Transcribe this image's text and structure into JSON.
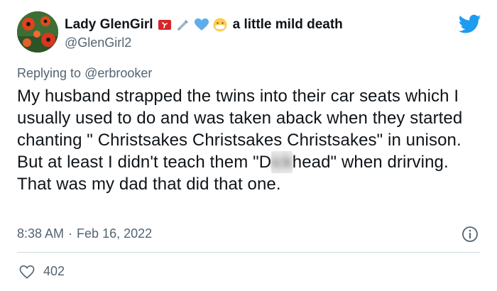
{
  "author": {
    "display_name": "Lady GlenGirl",
    "handle": "@GlenGirl2",
    "status_text": "a little mild death"
  },
  "status_emojis": [
    "isle-of-man-flag-icon",
    "syringe-icon",
    "blue-heart-icon",
    "medical-mask-face-icon"
  ],
  "reply": {
    "prefix": "Replying to",
    "mention": "@erbrooker"
  },
  "body": {
    "before_blur": "My husband strapped the twins into their car seats which I usually used to do and was taken aback when they started chanting \" Christsakes Christsakes Christsakes\" in unison. But at least I didn't teach them \"D",
    "blurred": "ick",
    "after_blur": "head\" when drirving. That was my dad that did that one."
  },
  "meta": {
    "time": "8:38 AM",
    "separator": "·",
    "date": "Feb 16, 2022"
  },
  "engagement": {
    "likes": "402"
  },
  "colors": {
    "twitter_blue": "#1d9bf0",
    "secondary_text": "#536471",
    "primary_text": "#0f1419",
    "divider": "#cfd9de"
  }
}
